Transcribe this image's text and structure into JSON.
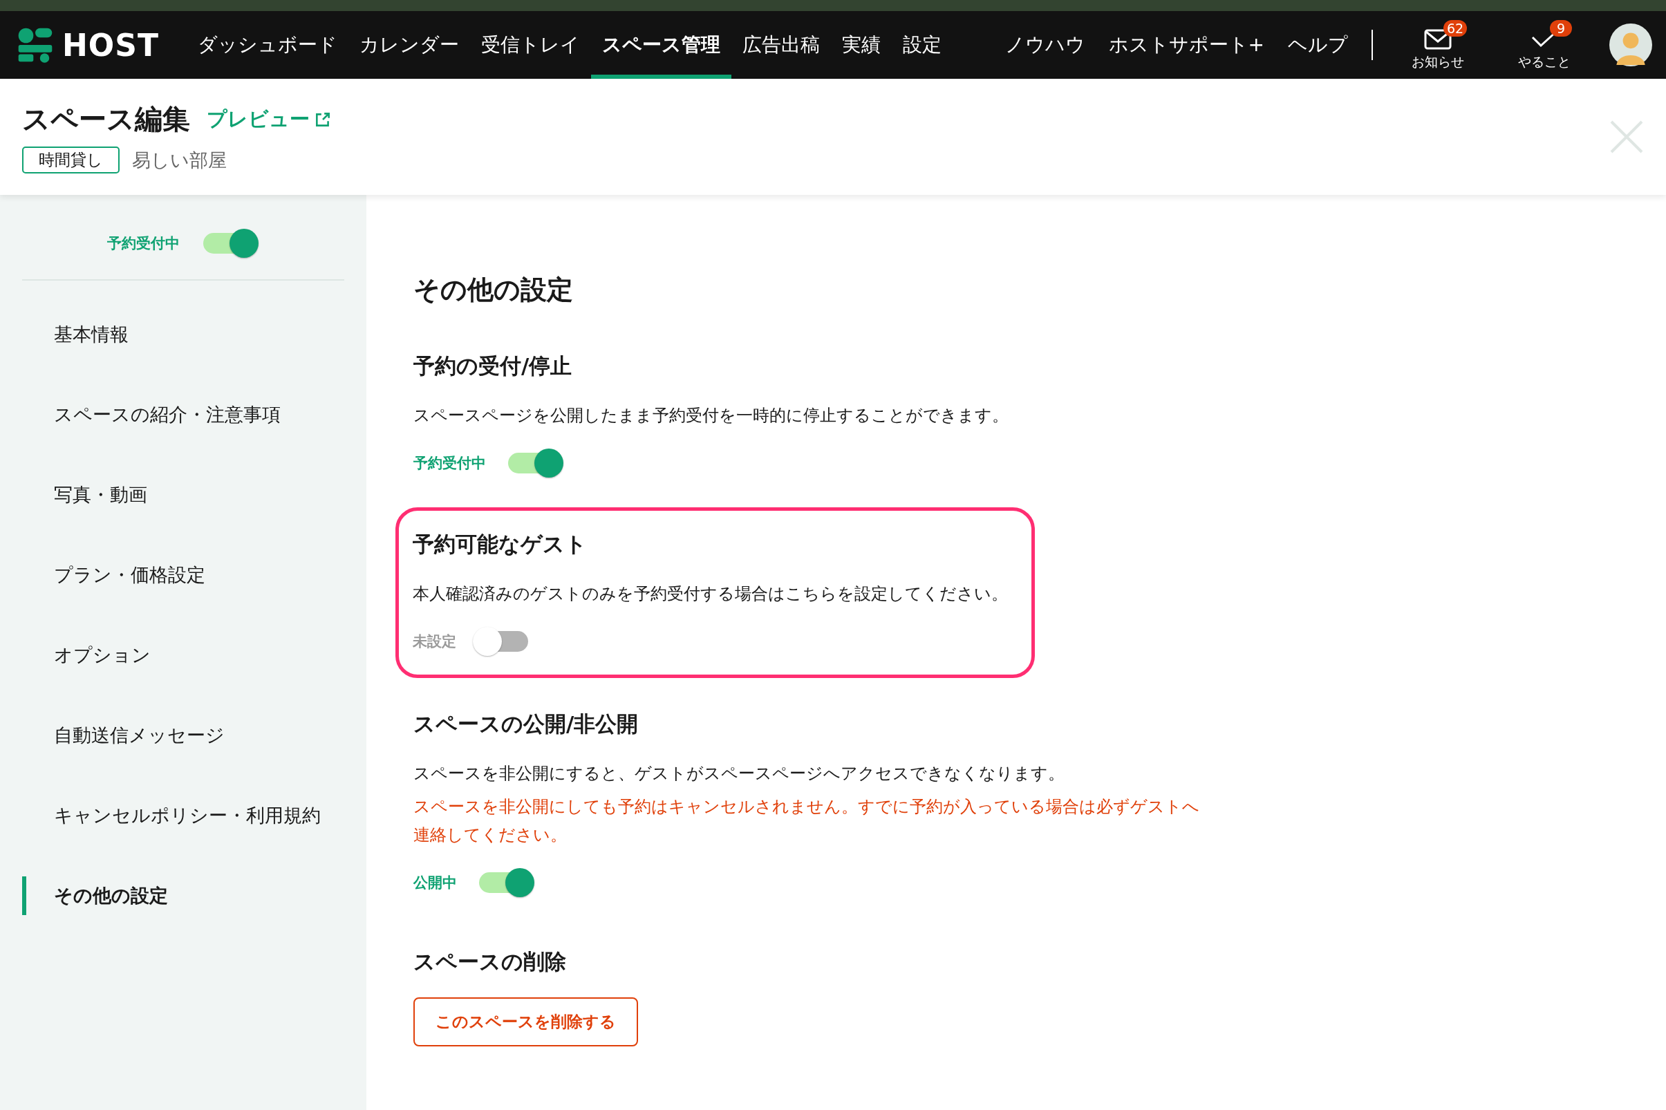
{
  "nav": {
    "logo": "HOST",
    "items": [
      {
        "label": "ダッシュボード",
        "selected": false
      },
      {
        "label": "カレンダー",
        "selected": false
      },
      {
        "label": "受信トレイ",
        "selected": false
      },
      {
        "label": "スペース管理",
        "selected": true
      },
      {
        "label": "広告出稿",
        "selected": false
      },
      {
        "label": "実績",
        "selected": false
      },
      {
        "label": "設定",
        "selected": false
      }
    ],
    "right_links": [
      "ノウハウ",
      "ホストサポート+",
      "ヘルプ"
    ],
    "icons": [
      {
        "kind": "mail",
        "label": "お知らせ",
        "badge": "62"
      },
      {
        "kind": "check",
        "label": "やること",
        "badge": "9"
      }
    ]
  },
  "page_header": {
    "title": "スペース編集",
    "preview_link": "プレビュー",
    "tag": "時間貸し",
    "space_name": "易しい部屋"
  },
  "sidebar": {
    "toggle": {
      "label": "予約受付中",
      "on": true
    },
    "items": [
      {
        "label": "基本情報",
        "selected": false
      },
      {
        "label": "スペースの紹介・注意事項",
        "selected": false
      },
      {
        "label": "写真・動画",
        "selected": false
      },
      {
        "label": "プラン・価格設定",
        "selected": false
      },
      {
        "label": "オプション",
        "selected": false
      },
      {
        "label": "自動送信メッセージ",
        "selected": false
      },
      {
        "label": "キャンセルポリシー・利用規約",
        "selected": false
      },
      {
        "label": "その他の設定",
        "selected": true
      }
    ]
  },
  "main": {
    "title": "その他の設定",
    "sections": [
      {
        "kind": "toggle",
        "title": "予約の受付/停止",
        "description": "スペースページを公開したまま予約受付を一時的に停止することができます。",
        "highlighted": false,
        "toggle": {
          "label": "予約受付中",
          "on": true
        }
      },
      {
        "kind": "toggle",
        "title": "予約可能なゲスト",
        "description": "本人確認済みのゲストのみを予約受付する場合はこちらを設定してください。",
        "highlighted": true,
        "toggle": {
          "label": "未設定",
          "on": false
        }
      },
      {
        "kind": "toggle",
        "title": "スペースの公開/非公開",
        "description": "スペースを非公開にすると、ゲストがスペースページへアクセスできなくなります。",
        "warning": "スペースを非公開にしても予約はキャンセルされません。すでに予約が入っている場合は必ずゲストへ連絡してください。",
        "highlighted": false,
        "toggle": {
          "label": "公開中",
          "on": true
        }
      },
      {
        "kind": "delete",
        "title": "スペースの削除",
        "button": "このスペースを削除する",
        "highlighted": false
      }
    ]
  }
}
